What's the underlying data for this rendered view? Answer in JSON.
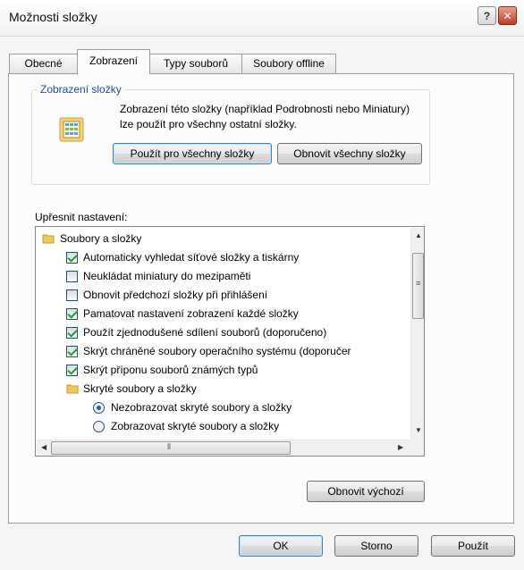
{
  "window": {
    "title": "Možnosti složky",
    "help_label": "?",
    "close_label": "✕"
  },
  "tabs": [
    {
      "label": "Obecné",
      "active": false
    },
    {
      "label": "Zobrazení",
      "active": true
    },
    {
      "label": "Typy souborů",
      "active": false
    },
    {
      "label": "Soubory offline",
      "active": false
    }
  ],
  "folder_view": {
    "group_label": "Zobrazení složky",
    "description": "Zobrazení této složky (například Podrobnosti nebo Miniatury) lze použít pro všechny ostatní složky.",
    "apply_all_label": "Použít pro všechny složky",
    "reset_all_label": "Obnovit všechny složky"
  },
  "advanced": {
    "label": "Upřesnit nastavení:",
    "items": [
      {
        "kind": "folder",
        "label": "Soubory a složky"
      },
      {
        "kind": "checkbox",
        "checked": true,
        "label": "Automaticky vyhledat síťové složky a tiskárny"
      },
      {
        "kind": "checkbox",
        "checked": false,
        "label": "Neukládat miniatury do mezipaměti"
      },
      {
        "kind": "checkbox",
        "checked": false,
        "label": "Obnovit předchozí složky při přihlášení"
      },
      {
        "kind": "checkbox",
        "checked": true,
        "label": "Pamatovat nastavení zobrazení každé složky"
      },
      {
        "kind": "checkbox",
        "checked": true,
        "label": "Použít zjednodušené sdílení souborů (doporučeno)"
      },
      {
        "kind": "checkbox",
        "checked": true,
        "label": "Skrýt chráněné soubory operačního systému (doporučer"
      },
      {
        "kind": "checkbox",
        "checked": true,
        "label": "Skrýt příponu souborů známých typů"
      },
      {
        "kind": "folder",
        "label": "Skryté soubory a složky"
      },
      {
        "kind": "radio",
        "checked": true,
        "label": "Nezobrazovat skryté soubory a složky"
      },
      {
        "kind": "radio",
        "checked": false,
        "label": "Zobrazovat skryté soubory a složky"
      }
    ],
    "restore_defaults_label": "Obnovit výchozí"
  },
  "footer": {
    "ok_label": "OK",
    "cancel_label": "Storno",
    "apply_label": "Použít"
  }
}
